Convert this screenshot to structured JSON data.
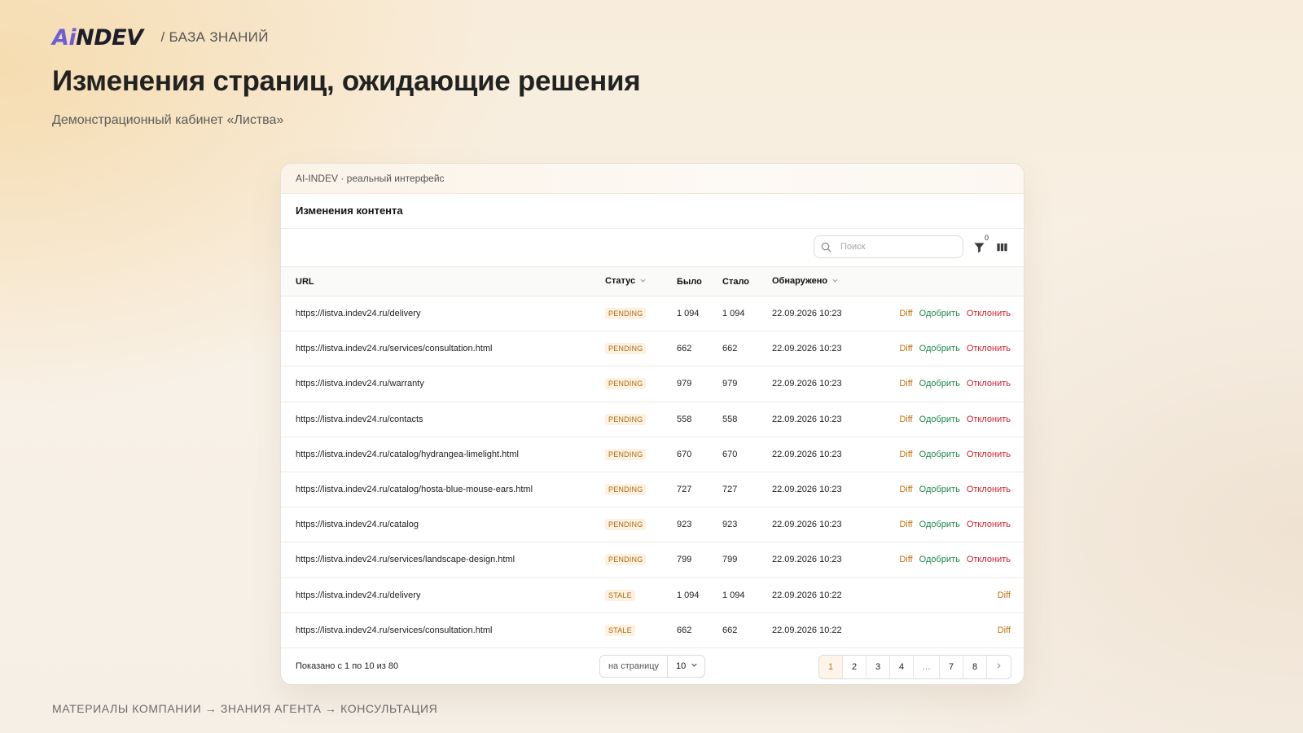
{
  "brand": {
    "logo_ai": "Ai",
    "logo_indev": "NDEV",
    "section": "/ БАЗА ЗНАНИЙ"
  },
  "page": {
    "title": "Изменения страниц, ожидающие решения",
    "subtitle": "Демонстрационный кабинет «Листва»",
    "footer_path": "МАТЕРИАЛЫ КОМПАНИИ → ЗНАНИЯ АГЕНТА → КОНСУЛЬТАЦИЯ"
  },
  "card": {
    "header": "AI-INDEV · реальный интерфейс",
    "section_title": "Изменения контента",
    "search_placeholder": "Поиск",
    "filter_count": "0"
  },
  "table": {
    "headers": {
      "url": "URL",
      "status": "Статус",
      "before": "Было",
      "after": "Стало",
      "detected": "Обнаружено"
    },
    "rows": [
      {
        "url": "https://listva.indev24.ru/delivery",
        "status": "PENDING",
        "before": "1 094",
        "after": "1 094",
        "detected": "22.09.2026 10:23",
        "actions": [
          "Diff",
          "Одобрить",
          "Отклонить"
        ]
      },
      {
        "url": "https://listva.indev24.ru/services/consultation.html",
        "status": "PENDING",
        "before": "662",
        "after": "662",
        "detected": "22.09.2026 10:23",
        "actions": [
          "Diff",
          "Одобрить",
          "Отклонить"
        ]
      },
      {
        "url": "https://listva.indev24.ru/warranty",
        "status": "PENDING",
        "before": "979",
        "after": "979",
        "detected": "22.09.2026 10:23",
        "actions": [
          "Diff",
          "Одобрить",
          "Отклонить"
        ]
      },
      {
        "url": "https://listva.indev24.ru/contacts",
        "status": "PENDING",
        "before": "558",
        "after": "558",
        "detected": "22.09.2026 10:23",
        "actions": [
          "Diff",
          "Одобрить",
          "Отклонить"
        ]
      },
      {
        "url": "https://listva.indev24.ru/catalog/hydrangea-limelight.html",
        "status": "PENDING",
        "before": "670",
        "after": "670",
        "detected": "22.09.2026 10:23",
        "actions": [
          "Diff",
          "Одобрить",
          "Отклонить"
        ]
      },
      {
        "url": "https://listva.indev24.ru/catalog/hosta-blue-mouse-ears.html",
        "status": "PENDING",
        "before": "727",
        "after": "727",
        "detected": "22.09.2026 10:23",
        "actions": [
          "Diff",
          "Одобрить",
          "Отклонить"
        ]
      },
      {
        "url": "https://listva.indev24.ru/catalog",
        "status": "PENDING",
        "before": "923",
        "after": "923",
        "detected": "22.09.2026 10:23",
        "actions": [
          "Diff",
          "Одобрить",
          "Отклонить"
        ]
      },
      {
        "url": "https://listva.indev24.ru/services/landscape-design.html",
        "status": "PENDING",
        "before": "799",
        "after": "799",
        "detected": "22.09.2026 10:23",
        "actions": [
          "Diff",
          "Одобрить",
          "Отклонить"
        ]
      },
      {
        "url": "https://listva.indev24.ru/delivery",
        "status": "STALE",
        "before": "1 094",
        "after": "1 094",
        "detected": "22.09.2026 10:22",
        "actions": [
          "Diff"
        ]
      },
      {
        "url": "https://listva.indev24.ru/services/consultation.html",
        "status": "STALE",
        "before": "662",
        "after": "662",
        "detected": "22.09.2026 10:22",
        "actions": [
          "Diff"
        ]
      }
    ]
  },
  "pagination": {
    "shown": "Показано с 1 по 10 из 80",
    "per_page_label": "на страницу",
    "per_page_value": "10",
    "pages": [
      "1",
      "2",
      "3",
      "4",
      "…",
      "7",
      "8"
    ],
    "active_page": "1"
  },
  "colors": {
    "accent": "#c0730f",
    "approve": "#1f8a4c",
    "reject": "#d01f2e",
    "logo_ai": "#6b5fd3",
    "logo_indev": "#1d1d2b"
  }
}
